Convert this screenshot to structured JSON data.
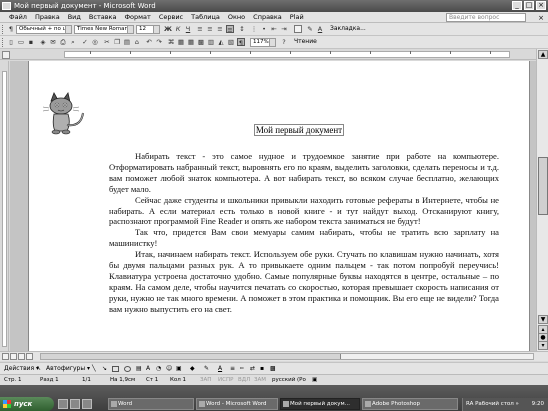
{
  "window": {
    "title": "Мой первый документ - Microsoft Word",
    "controls": [
      "_",
      "□",
      "×"
    ]
  },
  "menu": {
    "items": [
      "Файл",
      "Правка",
      "Вид",
      "Вставка",
      "Формат",
      "Сервис",
      "Таблица",
      "Окно",
      "Справка",
      "Plaй"
    ],
    "ask_placeholder": "Введите вопрос",
    "close": "×"
  },
  "format_toolbar": {
    "style_value": "Обычный + по ц",
    "font_value": "Times New Roman",
    "size_value": "12",
    "bookmark_label": "Закладка..."
  },
  "standard_toolbar": {
    "zoom_value": "117%",
    "read_label": "Чтение"
  },
  "document": {
    "title": "Мой первый документ",
    "paragraphs": [
      "Набирать текст - это самое нудное и трудоемкое занятие при работе на компьютере. Отформатировать набранный текст, выровнять его по краям, выделить заголовки, сделать переносы и т.д. вам поможет любой знаток компьютера. А вот набирать текст, во всяком случае бесплатно, желающих будет мало.",
      "Сейчас даже студенты и школьники привыкли находить готовые рефераты в Интернете, чтобы не набирать. А если материал есть только в новой книге - и тут найдут выход. Отсканируют книгу, распознают программой Fine Reader и опять же набором текста заниматься не будут!",
      "Так что, придется Вам свои мемуары самим набирать, чтобы не тратить всю зарплату на машинистку!",
      "Итак, начинаем набирать текст. Используем обе руки. Стучать по клавишам нужно начинать, хотя бы двумя пальцами разных рук. А то привыкаете одним пальцем - так потом попробуй переучись! Клавиатура устроена достаточно удобно. Самые популярные буквы находятся в центре, остальные – по краям. На самом деле, чтобы научится печатать со скоростью, которая превышает скорость написания от руки, нужно не так много времени. А поможет в этом практика и помощник. Вы его еще не видели? Тогда вам нужно выпустить его на свет."
    ]
  },
  "drawing_toolbar": {
    "actions_label": "Действия ▾",
    "autoshapes_label": "Автофигуры ▾"
  },
  "status_bar": {
    "page": "Стр. 1",
    "section": "Разд 1",
    "pages": "1/1",
    "position": "На 1,9см",
    "line": "Ст 1",
    "column": "Кол 1",
    "rec": "ЗАП",
    "trk": "ИСПР",
    "ext": "ВДЛ",
    "ovr": "ЗАМ",
    "language": "русский (Ро"
  },
  "taskbar": {
    "start_label": "пуск",
    "tasks": [
      "Word",
      "Word - Microsoft Word",
      "Мой первый докум...",
      "Adobe Photoshop"
    ],
    "tray_text": "RA   Рабочий стол »",
    "clock": "9:20"
  },
  "colors": {
    "title_bar": "#4a4a4a",
    "page": "#ffffff",
    "workspace": "#c4c4c4",
    "taskbar": "#3e3e3e"
  }
}
